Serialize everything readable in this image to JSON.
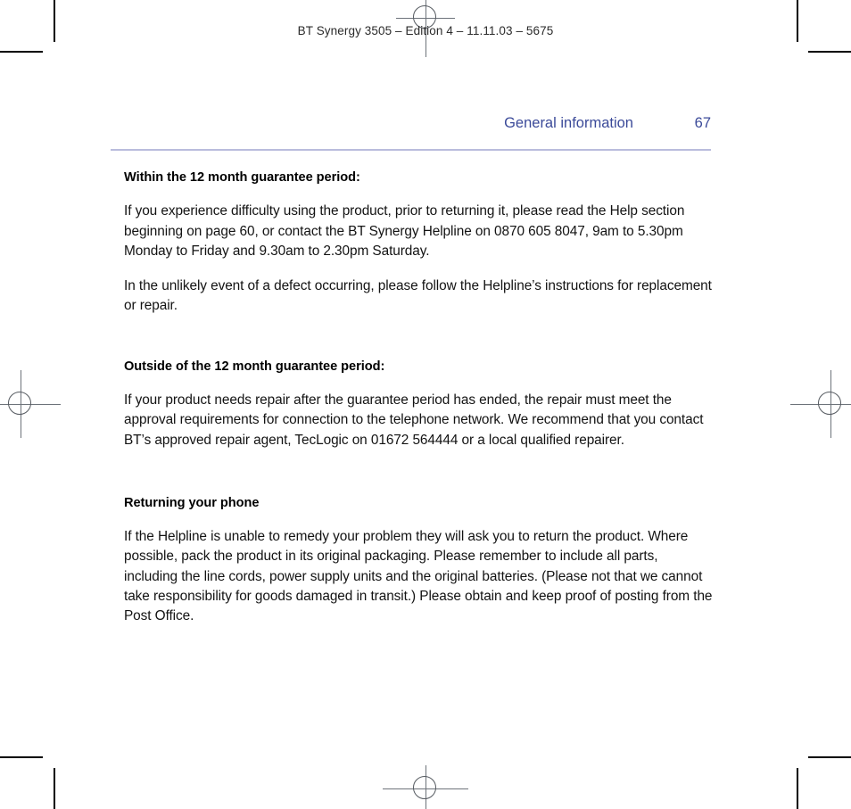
{
  "running_head": "BT Synergy 3505 – Edition 4 – 11.11.03 – 5675",
  "header": {
    "section_title": "General information",
    "page_number": "67",
    "rule_color": "#b9bcdd",
    "text_color": "#3b4a99"
  },
  "sections": [
    {
      "heading": "Within the 12 month guarantee period:",
      "paragraphs": [
        "If you experience difficulty using the product, prior to returning it, please read the Help section beginning on page 60, or contact the BT Synergy Helpline on 0870 605 8047, 9am to 5.30pm Monday to Friday and 9.30am to 2.30pm Saturday.",
        "In the unlikely event of a defect occurring, please follow the Helpline’s instructions for replacement or repair."
      ]
    },
    {
      "heading": "Outside of the 12 month guarantee period:",
      "paragraphs": [
        "If your product needs repair after the guarantee period has ended, the repair must meet the approval requirements for connection to the telephone network. We recommend that you contact BT’s approved repair agent, TecLogic on 01672 564444 or a local qualified repairer."
      ]
    },
    {
      "heading": "Returning your phone",
      "paragraphs": [
        "If the Helpline is unable to remedy your problem they will ask you to return the product. Where possible, pack the product in its original packaging. Please remember to include all parts, including the line cords, power supply units and the original batteries. (Please not that we cannot take responsibility for goods damaged in transit.) Please obtain and keep proof of posting from the Post Office."
      ]
    }
  ]
}
